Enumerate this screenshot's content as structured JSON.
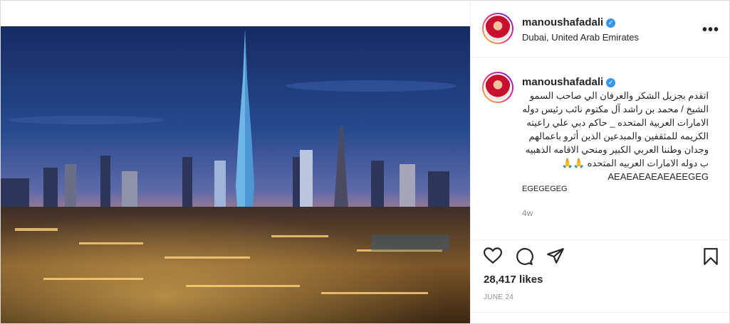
{
  "post": {
    "username": "manoushafadali",
    "location": "Dubai, United Arab Emirates",
    "more_label": "•••",
    "caption_text": "اتقدم بجزيل الشكر والعرفان الي صاحب السمو الشيخ / محمد بن راشد آل مكتوم نائب رئيس دوله الامارات العربية المتحده _ حاكم دبي علي راعيته الكريمه للمثقفين والمبدعين الذين أثرو باعمالهم وجدان وطننا العربي الكبير ومنحي الاقامه الذهبيه ب دوله الامارات العربيه المتحده 🙏🙏AEAEAEAEAEAEEGEG",
    "caption_tail": "EGEGEGEG",
    "time_ago": "4w",
    "likes": "28,417 likes",
    "date": "JUNE 24"
  },
  "icons": {
    "like": "heart-icon",
    "comment": "comment-icon",
    "share": "share-icon",
    "save": "bookmark-icon",
    "verified": "verified-badge-icon"
  },
  "colors": {
    "verified": "#3897f0",
    "muted": "#8e8e8e",
    "text": "#262626"
  }
}
